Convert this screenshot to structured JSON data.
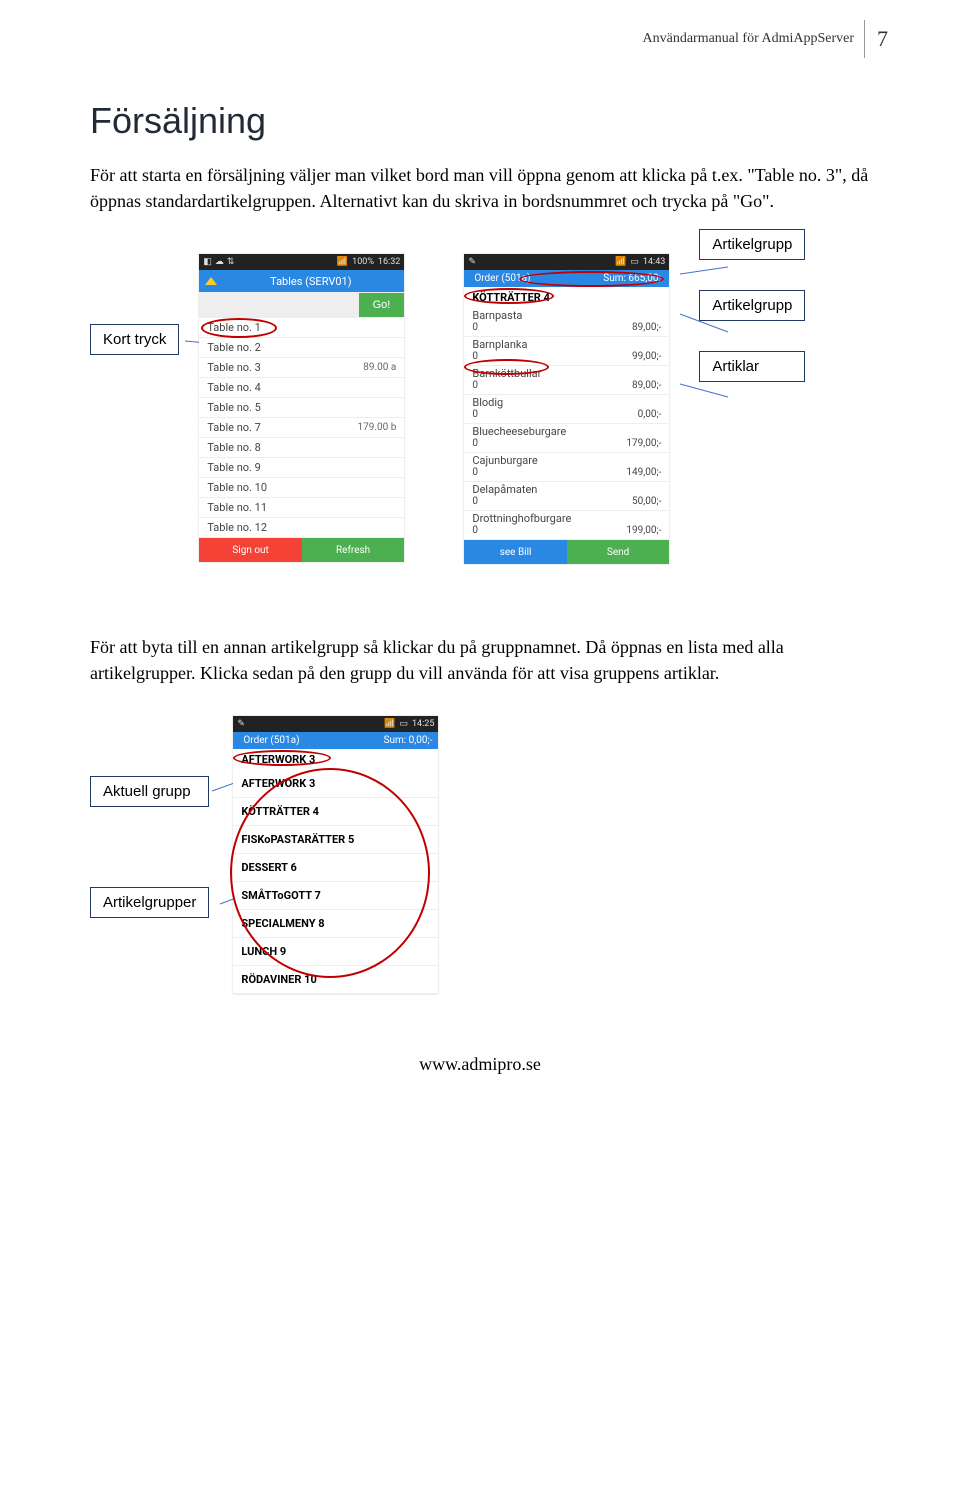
{
  "header": {
    "manual_title": "Användarmanual för AdmiAppServer",
    "page_number": "7"
  },
  "section": {
    "title": "Försäljning",
    "para1": "För att starta en försäljning väljer man vilket bord man vill öppna genom att klicka på t.ex. \"Table no. 3\", då öppnas standardartikelgruppen. Alternativt kan du skriva in bordsnummret och trycka på \"Go\".",
    "para2": "För att byta till en annan artikelgrupp så klickar du på gruppnamnet. Då öppnas en lista med alla artikelgrupper. Klicka sedan på den grupp du vill använda för att visa gruppens artiklar."
  },
  "callouts": {
    "kort_tryck": "Kort tryck",
    "artikelgrupp": "Artikelgrupp",
    "artiklar": "Artiklar",
    "aktuell_grupp": "Aktuell grupp",
    "artikelgrupper": "Artikelgrupper"
  },
  "phone1": {
    "status_time": "16:32",
    "status_battery": "100%",
    "title": "Tables (SERV01)",
    "go_label": "Go!",
    "tables": [
      {
        "label": "Table no. 1",
        "price": ""
      },
      {
        "label": "Table no. 2",
        "price": ""
      },
      {
        "label": "Table no. 3",
        "price": "89.00 a"
      },
      {
        "label": "Table no. 4",
        "price": ""
      },
      {
        "label": "Table no. 5",
        "price": ""
      },
      {
        "label": "Table no. 7",
        "price": "179.00 b"
      },
      {
        "label": "Table no. 8",
        "price": ""
      },
      {
        "label": "Table no. 9",
        "price": ""
      },
      {
        "label": "Table no. 10",
        "price": ""
      },
      {
        "label": "Table no. 11",
        "price": ""
      },
      {
        "label": "Table no. 12",
        "price": ""
      }
    ],
    "sign_out": "Sign out",
    "refresh": "Refresh"
  },
  "phone2": {
    "status_time": "14:43",
    "order_title": "Order (501a)",
    "order_sum": "Sum: 665,00;-",
    "group_header": "KÖTTRÄTTER 4",
    "items": [
      {
        "name": "Barnpasta",
        "qty": "0",
        "price": "89,00;-"
      },
      {
        "name": "Barnplanka",
        "qty": "0",
        "price": "99,00;-"
      },
      {
        "name": "Barnköttbullar",
        "qty": "0",
        "price": "89,00;-"
      },
      {
        "name": "Blodig",
        "qty": "0",
        "price": "0,00;-"
      },
      {
        "name": "Bluecheeseburgare",
        "qty": "0",
        "price": "179,00;-"
      },
      {
        "name": "Cajunburgare",
        "qty": "0",
        "price": "149,00;-"
      },
      {
        "name": "Delapåmaten",
        "qty": "0",
        "price": "50,00;-"
      },
      {
        "name": "Drottninghofburgare",
        "qty": "0",
        "price": "199,00;-"
      }
    ],
    "see_bill": "see Bill",
    "send": "Send"
  },
  "phone3": {
    "status_time": "14:25",
    "order_title": "Order (501a)",
    "order_sum": "Sum: 0,00;-",
    "current": "AFTERWORK 3",
    "groups": [
      "AFTERWORK 3",
      "KÖTTRÄTTER 4",
      "FISKoPASTARÄTTER 5",
      "DESSERT 6",
      "SMÅTToGOTT 7",
      "SPECIALMENY 8",
      "LUNCH 9",
      "RÖDAVINER 10"
    ]
  },
  "footer": {
    "url": "www.admipro.se"
  }
}
